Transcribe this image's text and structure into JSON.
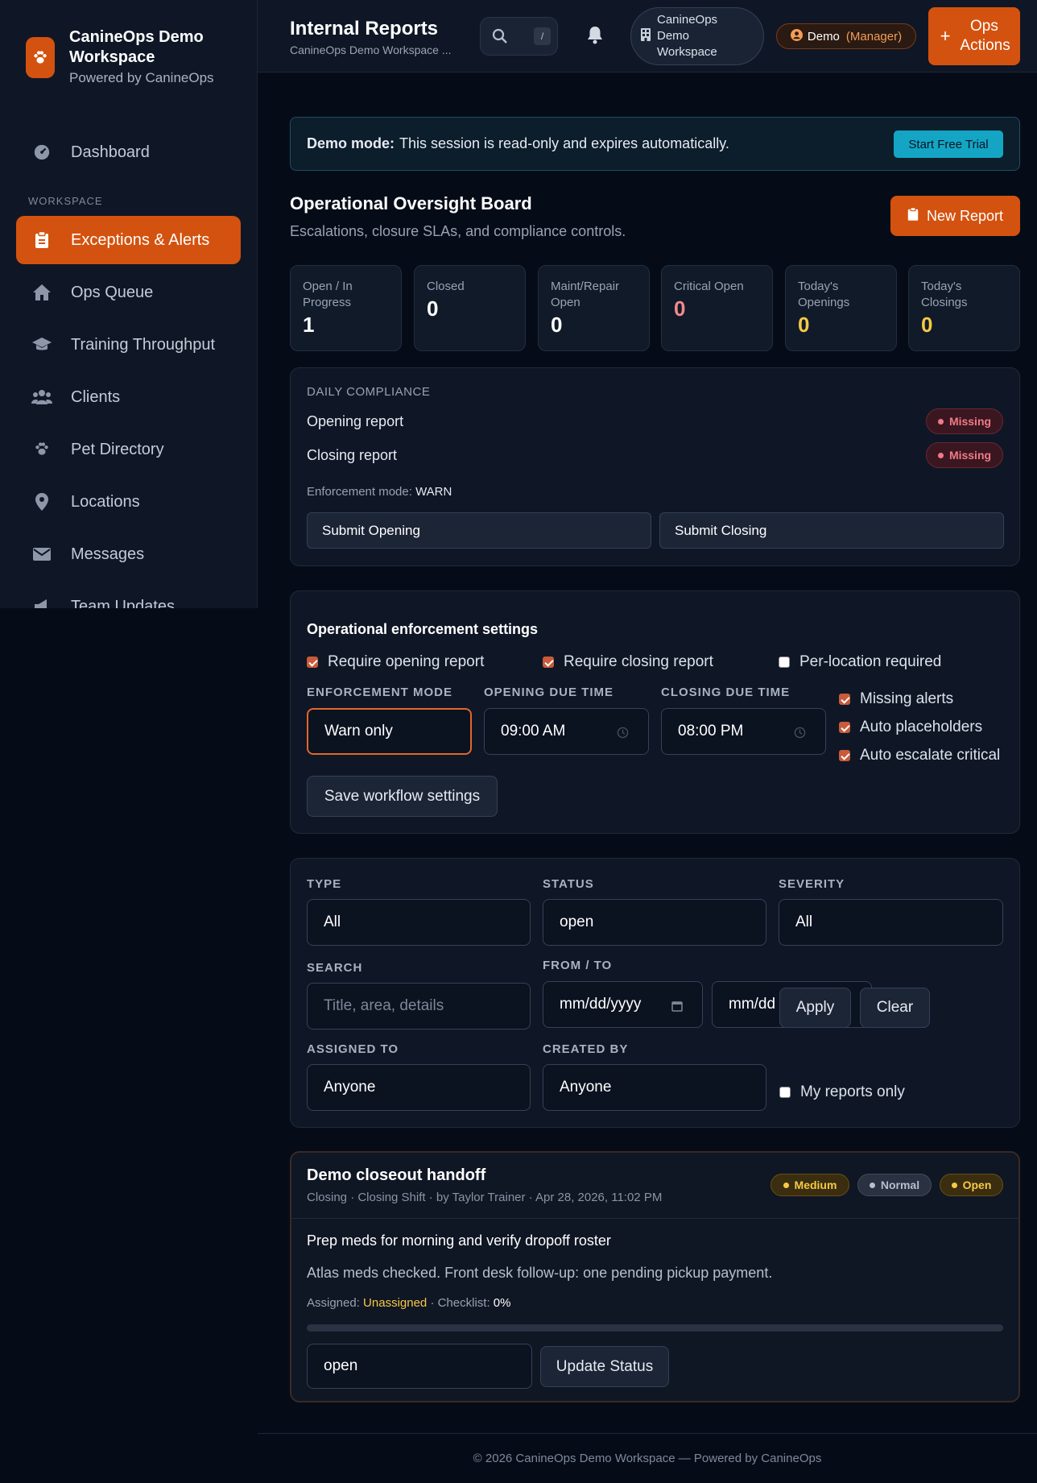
{
  "brand": {
    "title": "CanineOps Demo Workspace",
    "subtitle": "Powered by CanineOps",
    "accent": "#d4520f"
  },
  "sidebar": {
    "section_label": "WORKSPACE",
    "items": [
      {
        "label": "Dashboard",
        "icon": "gauge-icon"
      },
      {
        "label": "Exceptions & Alerts",
        "icon": "clipboard-icon",
        "active": true
      },
      {
        "label": "Ops Queue",
        "icon": "home-icon"
      },
      {
        "label": "Training Throughput",
        "icon": "graduation-cap-icon"
      },
      {
        "label": "Clients",
        "icon": "users-icon"
      },
      {
        "label": "Pet Directory",
        "icon": "paw-icon"
      },
      {
        "label": "Locations",
        "icon": "map-pin-icon"
      },
      {
        "label": "Messages",
        "icon": "envelope-icon"
      },
      {
        "label": "Team Updates",
        "icon": "megaphone-icon"
      }
    ]
  },
  "header": {
    "title": "Internal Reports",
    "subtitle": "CanineOps Demo Workspace ...",
    "search_shortcut": "/",
    "workspace": "CanineOps Demo Workspace",
    "user_name": "Demo",
    "user_role": "(Manager)",
    "ops_actions": "Ops Actions"
  },
  "banner": {
    "strong": "Demo mode:",
    "text": "This session is read-only and expires automatically.",
    "cta": "Start Free Trial"
  },
  "board": {
    "title": "Operational Oversight Board",
    "subtitle": "Escalations, closure SLAs, and compliance controls.",
    "new_report": "New Report"
  },
  "stats": [
    {
      "label": "Open / In Progress",
      "value": "1"
    },
    {
      "label": "Closed",
      "value": "0"
    },
    {
      "label": "Maint/Repair Open",
      "value": "0"
    },
    {
      "label": "Critical Open",
      "value": "0"
    },
    {
      "label": "Today's Openings",
      "value": "0"
    },
    {
      "label": "Today's Closings",
      "value": "0"
    }
  ],
  "compliance": {
    "caption": "DAILY COMPLIANCE",
    "opening_label": "Opening report",
    "closing_label": "Closing report",
    "status": "Missing",
    "mode_label": "Enforcement mode:",
    "mode_value": "WARN",
    "submit_opening": "Submit Opening",
    "submit_closing": "Submit Closing"
  },
  "settings": {
    "title": "Operational enforcement settings",
    "require_opening": "Require opening report",
    "require_closing": "Require closing report",
    "per_location": "Per-location required",
    "mode_label": "ENFORCEMENT MODE",
    "mode_value": "Warn only",
    "opening_due_label": "OPENING DUE TIME",
    "opening_due": "09:00 AM",
    "closing_due_label": "CLOSING DUE TIME",
    "closing_due": "08:00 PM",
    "missing_alerts": "Missing alerts",
    "auto_placeholders": "Auto placeholders",
    "auto_escalate": "Auto escalate critical",
    "save": "Save workflow settings"
  },
  "filters": {
    "type_label": "TYPE",
    "type_value": "All",
    "status_label": "STATUS",
    "status_value": "open",
    "severity_label": "SEVERITY",
    "severity_value": "All",
    "search_label": "SEARCH",
    "search_placeholder": "Title, area, details",
    "range_label": "FROM / TO",
    "from_placeholder": "mm/dd/yyyy",
    "to_placeholder": "mm/dd",
    "apply": "Apply",
    "clear": "Clear",
    "assigned_label": "ASSIGNED TO",
    "assigned_value": "Anyone",
    "created_label": "CREATED BY",
    "created_value": "Anyone",
    "mine": "My reports only"
  },
  "report": {
    "title": "Demo closeout handoff",
    "meta": "Closing · Closing Shift · by Taylor Trainer · Apr 28, 2026, 11:02 PM",
    "badge_severity": "Medium",
    "badge_priority": "Normal",
    "badge_status": "Open",
    "summary": "Prep meds for morning and verify dropoff roster",
    "details": "Atlas meds checked. Front desk follow-up: one pending pickup payment.",
    "assigned_label": "Assigned:",
    "assigned_value": "Unassigned",
    "checklist_label": "· Checklist:",
    "checklist_value": "0%",
    "checklist_progress": 0,
    "status_value": "open",
    "update_btn": "Update Status"
  },
  "footer": "© 2026 CanineOps Demo Workspace — Powered by CanineOps"
}
